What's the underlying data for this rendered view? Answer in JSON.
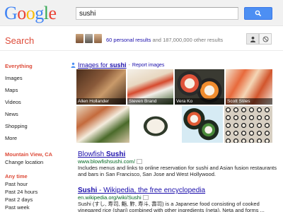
{
  "header": {
    "logo_letters": [
      {
        "char": "G",
        "color": "#4285f4"
      },
      {
        "char": "o",
        "color": "#ea4335"
      },
      {
        "char": "o",
        "color": "#fbbc05"
      },
      {
        "char": "g",
        "color": "#4285f4"
      },
      {
        "char": "l",
        "color": "#34a853"
      },
      {
        "char": "e",
        "color": "#ea4335"
      }
    ],
    "search_value": "sushi",
    "search_button_icon": "magnifier-icon"
  },
  "subbar": {
    "label": "Search",
    "personal_results": "60 personal results",
    "other_results": "and 187,000,000 other results"
  },
  "sidebar": {
    "items": [
      "Everything",
      "Images",
      "Maps",
      "Videos",
      "News",
      "Shopping",
      "More"
    ],
    "location_heading": "Mountain View, CA",
    "change_location": "Change location",
    "time_heading": "Any time",
    "time_items": [
      "Past hour",
      "Past 24 hours",
      "Past 2 days",
      "Past week"
    ]
  },
  "images": {
    "prefix": "Images for ",
    "query": "sushi",
    "report": "Report images",
    "captions": [
      "Allen Hollander",
      "Steven Brand",
      "Vera Ko",
      "Scott Stiles"
    ]
  },
  "results": [
    {
      "title_prefix": "Blowfish ",
      "title_bold": "Sushi",
      "url": "www.blowfishsushi.com/",
      "snippet": "Includes menus and links to online reservation for sushi and Asian fusion restaurants and bars in San Francisco, San Jose and West Hollywood."
    },
    {
      "title_prefix": "",
      "title_bold": "Sushi",
      "title_suffix": " - Wikipedia, the free encyclopedia",
      "url": "en.wikipedia.org/wiki/Sushi",
      "snippet": "Sushi (すし, 寿司, 鮨, 鮓, 寿斗, 壽司) is a Japanese food consisting of cooked vinegared rice (shari) combined with other ingredients (neta). Neta and forms ..."
    }
  ],
  "colors": {
    "accent_red": "#dd4b39",
    "link_blue": "#1a0dab",
    "url_green": "#006621",
    "button_blue": "#4d8ff3"
  }
}
